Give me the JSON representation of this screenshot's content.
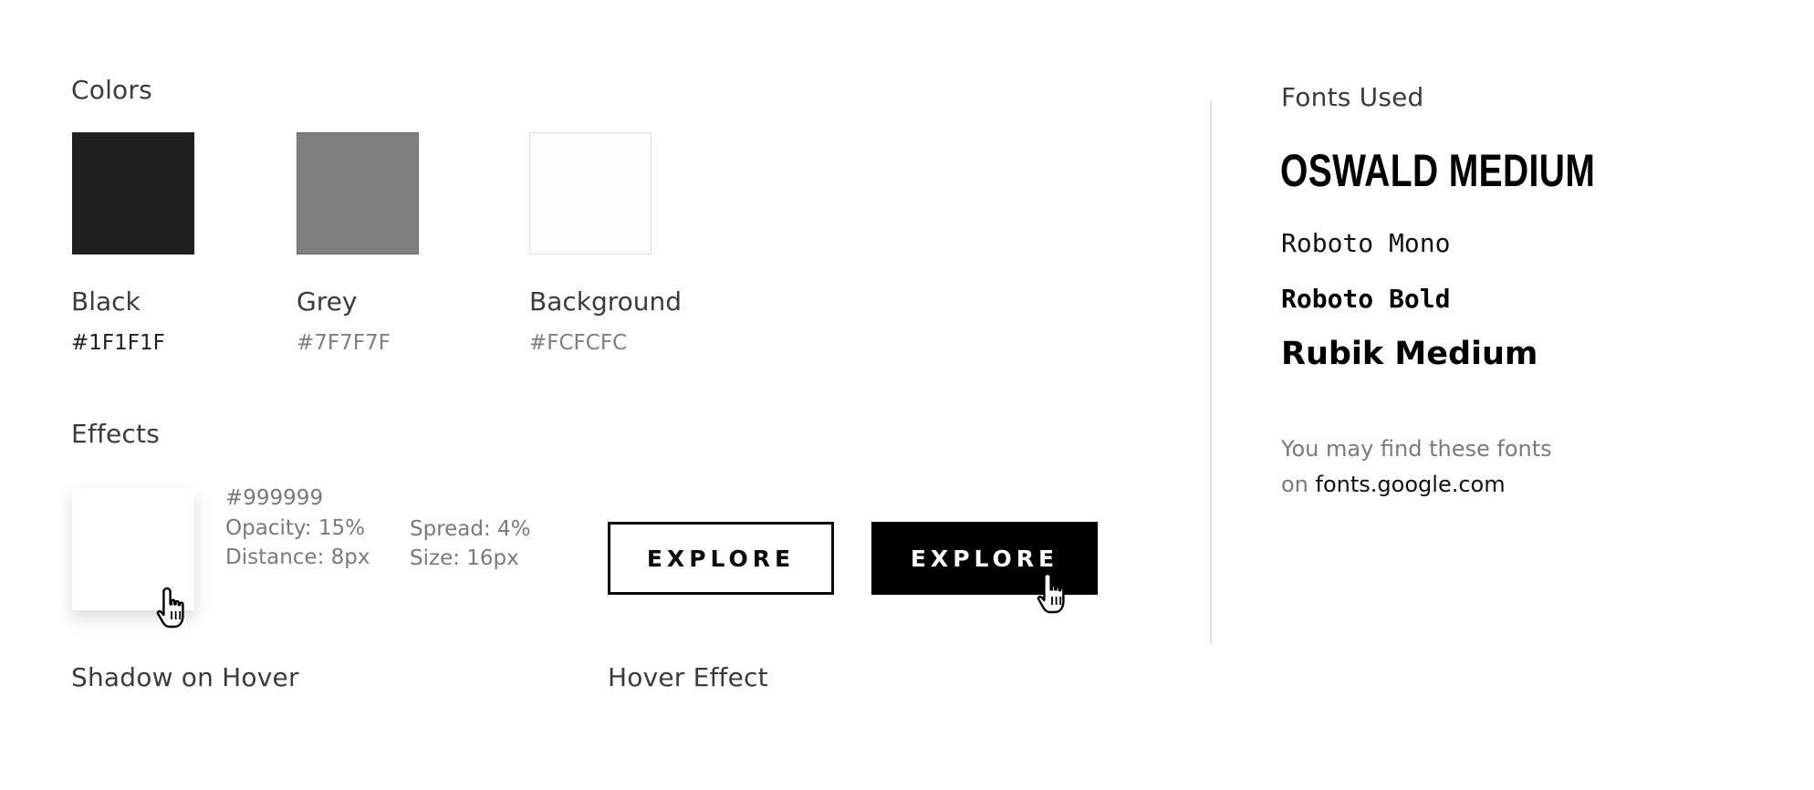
{
  "colors": {
    "title": "Colors",
    "swatches": [
      {
        "name": "Black",
        "hex": "#1F1F1F",
        "color": "#1F1F1F",
        "hex_text_color": "#1F1F1F"
      },
      {
        "name": "Grey",
        "hex": "#7F7F7F",
        "color": "#7F7F7F",
        "hex_text_color": "#7F7F7F"
      },
      {
        "name": "Background",
        "hex": "#FCFCFC",
        "color": "#FCFCFC",
        "hex_text_color": "#7F7F7F"
      }
    ]
  },
  "effects": {
    "title": "Effects",
    "shadow": {
      "color": "#999999",
      "opacity": "Opacity: 15%",
      "distance": "Distance: 8px",
      "spread": "Spread: 4%",
      "size": "Size: 16px",
      "caption": "Shadow on Hover"
    },
    "hover": {
      "outline_label": "EXPLORE",
      "solid_label": "EXPLORE",
      "caption": "Hover Effect"
    },
    "cursor_icon": "hand-pointer-icon"
  },
  "fonts": {
    "title": "Fonts Used",
    "samples": [
      "OSWALD MEDIUM",
      "Roboto Mono",
      "Roboto Bold",
      "Rubik Medium"
    ],
    "note_line1": "You may find these fonts",
    "note_on": "on",
    "note_link": "fonts.google.com"
  }
}
